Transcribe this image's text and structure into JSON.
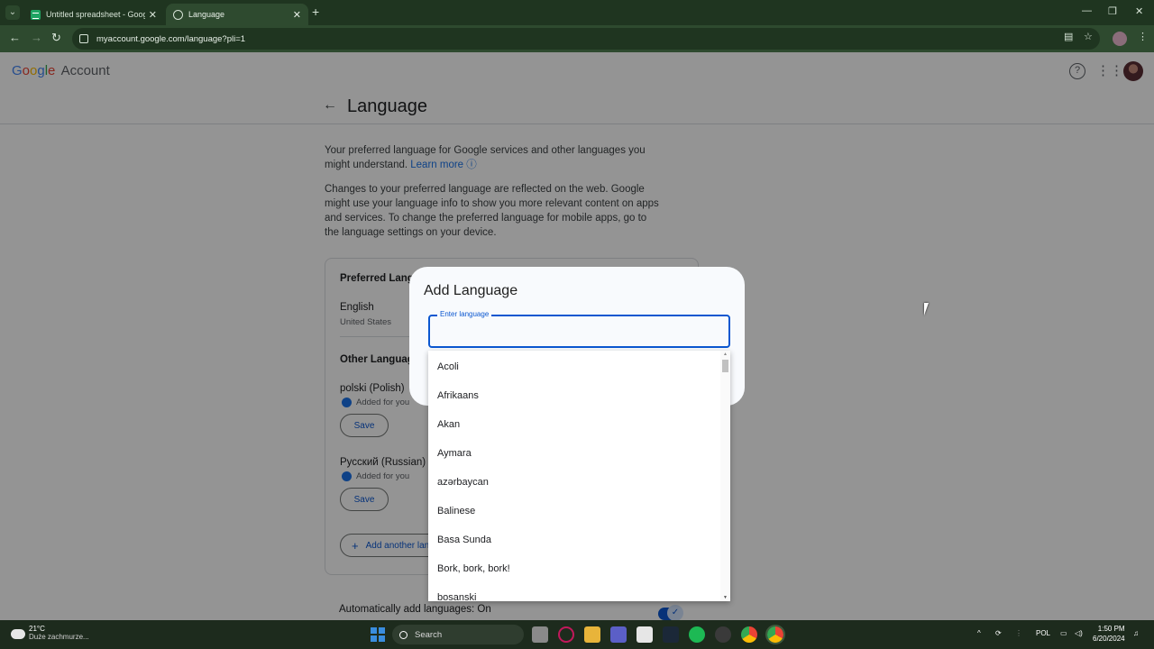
{
  "browser": {
    "tabs": [
      {
        "title": "Untitled spreadsheet - Google S",
        "icon": "sheets-icon",
        "active": false
      },
      {
        "title": "Language",
        "icon": "globe-icon",
        "active": true
      }
    ],
    "url": "myaccount.google.com/language?pli=1"
  },
  "header": {
    "logo": {
      "g": "G",
      "o1": "o",
      "o2": "o",
      "g2": "g",
      "l": "l",
      "e": "e",
      "account": "Account"
    },
    "help_glyph": "?",
    "apps_glyph": "⋮⋮⋮"
  },
  "page": {
    "title": "Language",
    "desc1": "Your preferred language for Google services and other languages you might understand.",
    "learn_more": "Learn more",
    "desc2": "Changes to your preferred language are reflected on the web. Google might use your language info to show you more relevant content on apps and ser­vices. To change the preferred language for mobile apps, go to the lan­guage settings on your device.",
    "preferred_heading": "Preferred Language",
    "preferred_lang": "English",
    "preferred_region": "United States",
    "other_heading": "Other Languages",
    "others": [
      {
        "name": "polski (Polish)",
        "note": "Added for you",
        "action": "Save"
      },
      {
        "name": "Русский (Russian)",
        "note": "Added for you",
        "action": "Save"
      }
    ],
    "add_another": "Add another language",
    "auto_add": "Automatically add languages: On"
  },
  "dialog": {
    "title": "Add Language",
    "field_label": "Enter language",
    "field_value": "",
    "options": [
      "Acoli",
      "Afrikaans",
      "Akan",
      "Aymara",
      "azərbaycan",
      "Balinese",
      "Basa Sunda",
      "Bork, bork, bork!",
      "bosanski"
    ]
  },
  "taskbar": {
    "temp": "21°C",
    "weather": "Duże zachmurze...",
    "search": "Search",
    "lang": "POL",
    "time": "1:50 PM",
    "date": "6/20/2024"
  }
}
